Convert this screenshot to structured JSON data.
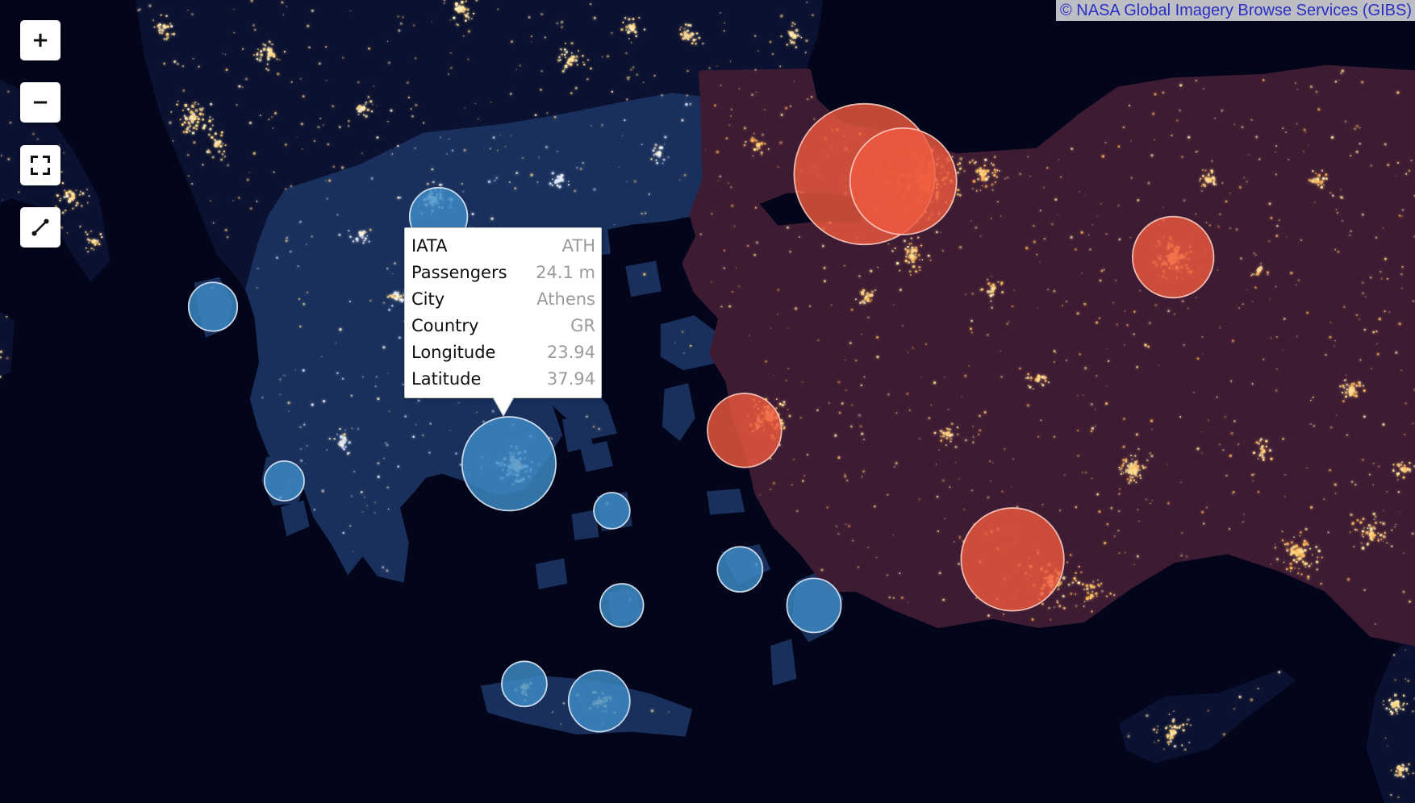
{
  "attribution": {
    "text": "© NASA Global Imagery Browse Services (GIBS)"
  },
  "controls": {
    "zoom_in": {
      "label": "+",
      "icon": "plus-icon"
    },
    "zoom_out": {
      "label": "−",
      "icon": "minus-icon"
    },
    "fullscreen": {
      "icon": "fullscreen-icon"
    },
    "measure": {
      "icon": "measure-line-icon"
    }
  },
  "tooltip": {
    "rows": [
      {
        "label": "IATA",
        "value": "ATH"
      },
      {
        "label": "Passengers",
        "value": "24.1 m"
      },
      {
        "label": "City",
        "value": "Athens"
      },
      {
        "label": "Country",
        "value": "GR"
      },
      {
        "label": "Longitude",
        "value": "23.94"
      },
      {
        "label": "Latitude",
        "value": "37.94"
      }
    ]
  },
  "colors": {
    "sea": "#03051a",
    "land": "#0b1130",
    "greece_overlay": "#19305c",
    "turkey_overlay": "#3d1b33",
    "greece_marker": "#3f8fcc",
    "greece_marker_stroke": "#dbe8f4",
    "turkey_marker": "#f05a3e",
    "turkey_marker_stroke": "#f9c9bd",
    "city_lights": "#ffd98a"
  }
}
